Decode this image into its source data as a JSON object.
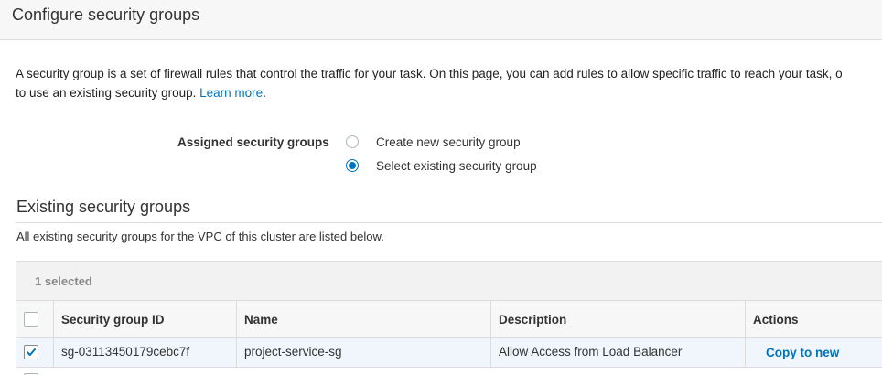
{
  "page": {
    "title": "Configure security groups"
  },
  "intro": {
    "text_line1": "A security group is a set of firewall rules that control the traffic for your task. On this page, you can add rules to allow specific traffic to reach your task, o",
    "text_line2_prefix": "to use an existing security group. ",
    "learn_more_label": "Learn more",
    "text_line2_suffix": "."
  },
  "assigned": {
    "label": "Assigned security groups",
    "options": [
      {
        "label": "Create new security group",
        "selected": false
      },
      {
        "label": "Select existing security group",
        "selected": true
      }
    ]
  },
  "existing": {
    "title": "Existing security groups",
    "description": "All existing security groups for the VPC of this cluster are listed below."
  },
  "table": {
    "selected_count": "1 selected",
    "headers": {
      "id": "Security group ID",
      "name": "Name",
      "description": "Description",
      "actions": "Actions"
    },
    "rows": [
      {
        "checked": true,
        "id": "sg-03113450179cebc7f",
        "name": "project-service-sg",
        "description": "Allow Access from Load Balancer",
        "action_label": "Copy to new"
      }
    ]
  },
  "colors": {
    "accent": "#0073bb",
    "selected_row_bg": "#f0f6fc",
    "header_bg": "#f7f7f7",
    "border": "#dcdcdc"
  }
}
